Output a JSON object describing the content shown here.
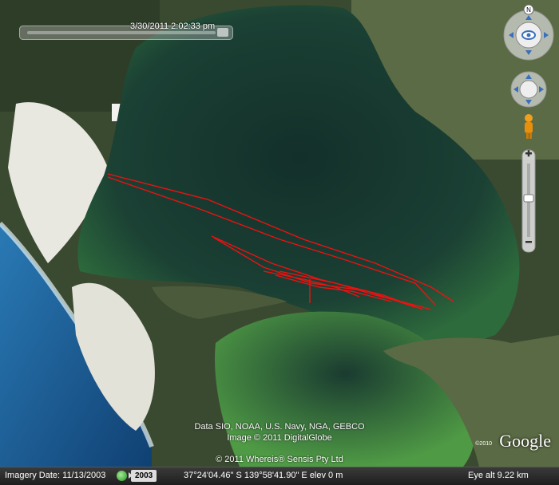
{
  "time_slider": {
    "label": "3/30/2011   2:02:33 pm"
  },
  "credits": {
    "line1": "Data SIO, NOAA, U.S. Navy, NGA, GEBCO",
    "line2": "Image © 2011 DigitalGlobe",
    "line3": "© 2011 Whereis® Sensis Pty Ltd"
  },
  "logo": {
    "text": "Google",
    "year": "©2010"
  },
  "status_bar": {
    "imagery_date": "Imagery Date: 11/13/2003",
    "historical_year": "2003",
    "coordinates": "37°24'04.46\" S  139°58'41.90\" E  elev    0 m",
    "eye_alt": "Eye alt    9.22 km"
  },
  "nav_controls": {
    "north_label": "N",
    "icons": [
      "look-joystick-icon",
      "move-joystick-icon",
      "street-view-pegman-icon",
      "zoom-in-icon",
      "zoom-out-icon",
      "zoom-slider-icon"
    ]
  },
  "colors": {
    "track": "#ee1111",
    "water": "#1d3e33",
    "ocean": "#164f86",
    "dune": "#e8e8e0"
  }
}
